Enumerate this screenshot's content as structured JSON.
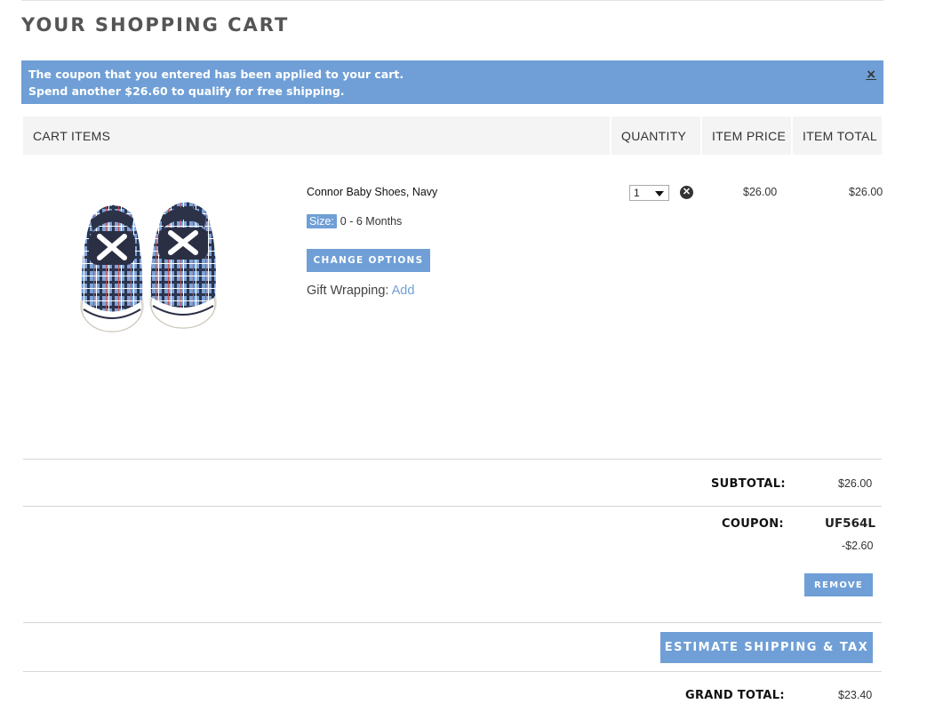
{
  "page": {
    "title": "YOUR SHOPPING CART"
  },
  "notice": {
    "line1": "The coupon that you entered has been applied to your cart.",
    "line2": "Spend another $26.60 to qualify for free shipping.",
    "close_label": "×"
  },
  "table": {
    "headers": {
      "items": "CART ITEMS",
      "quantity": "QUANTITY",
      "item_price": "ITEM PRICE",
      "item_total": "ITEM TOTAL"
    }
  },
  "item": {
    "name": "Connor Baby Shoes, Navy",
    "size_label": "Size:",
    "size_value": "0 - 6 Months",
    "change_options_label": "CHANGE OPTIONS",
    "gift_wrapping_label": "Gift Wrapping: ",
    "gift_wrapping_action": "Add",
    "quantity": "1",
    "item_price": "$26.00",
    "item_total": "$26.00",
    "image_icon": "baby-shoes-plaid-navy"
  },
  "summary": {
    "subtotal_label": "SUBTOTAL:",
    "subtotal_value": "$26.00",
    "coupon_label": "COUPON:",
    "coupon_code": "UF564L",
    "coupon_discount": "-$2.60",
    "remove_label": "REMOVE",
    "estimate_label": "ESTIMATE SHIPPING & TAX",
    "grand_total_label": "GRAND TOTAL:",
    "grand_total_value": "$23.40"
  },
  "colors": {
    "accent": "#6f9fd6",
    "header_bg": "#f4f4f4"
  }
}
